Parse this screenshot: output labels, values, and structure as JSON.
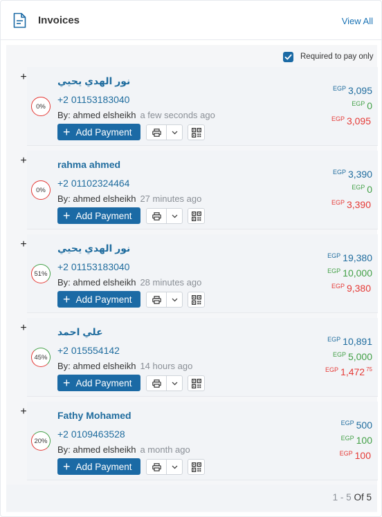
{
  "header": {
    "title": "Invoices",
    "view_all": "View All"
  },
  "filter": {
    "required_label": "Required to pay only",
    "checked": true
  },
  "currency": "EGP",
  "add_payment_label": "Add Payment",
  "invoices": [
    {
      "name": "نور الهدي يحيي",
      "phone": "+2 01153183040",
      "by": "By: ahmed elsheikh",
      "time": "a few seconds ago",
      "percent": "0%",
      "total": "3,095",
      "paid": "0",
      "due": "3,095",
      "due_decimal": ""
    },
    {
      "name": "rahma ahmed",
      "phone": "+2 01102324464",
      "by": "By: ahmed elsheikh",
      "time": "27 minutes ago",
      "percent": "0%",
      "total": "3,390",
      "paid": "0",
      "due": "3,390",
      "due_decimal": ""
    },
    {
      "name": "نور الهدي يحيي",
      "phone": "+2 01153183040",
      "by": "By: ahmed elsheikh",
      "time": "28 minutes ago",
      "percent": "51%",
      "total": "19,380",
      "paid": "10,000",
      "due": "9,380",
      "due_decimal": ""
    },
    {
      "name": "علي احمد",
      "phone": "+2 015554142",
      "by": "By: ahmed elsheikh",
      "time": "14 hours ago",
      "percent": "45%",
      "total": "10,891",
      "paid": "5,000",
      "due": "1,472",
      "due_decimal": "75"
    },
    {
      "name": "Fathy Mohamed",
      "phone": "+2 0109463528",
      "by": "By: ahmed elsheikh",
      "time": "a month ago",
      "percent": "20%",
      "total": "500",
      "paid": "100",
      "due": "100",
      "due_decimal": ""
    }
  ],
  "pagination": {
    "range": "1 - 5",
    "of_label": "Of",
    "total": "5"
  },
  "colors": {
    "primary": "#1b6aa5",
    "link": "#1f6c9e",
    "paid": "#43a047",
    "due": "#e53935"
  }
}
